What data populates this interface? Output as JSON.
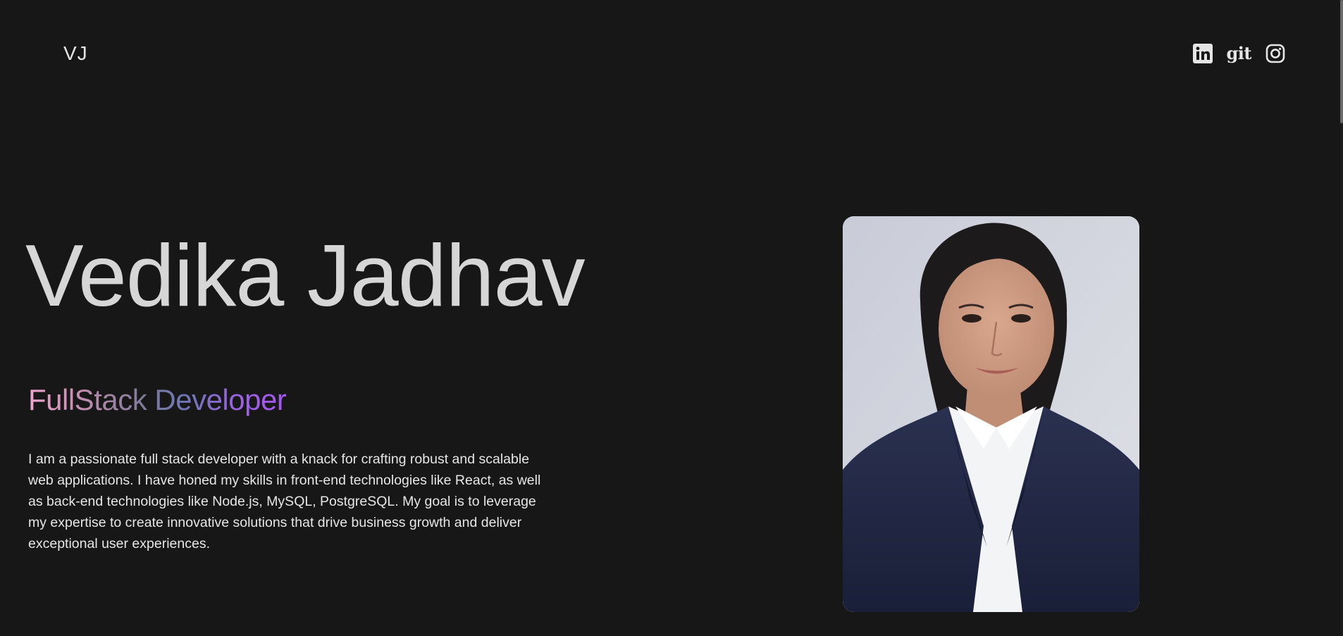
{
  "header": {
    "logo": "VJ",
    "socials": [
      {
        "icon": "linkedin-icon",
        "label": "LinkedIn"
      },
      {
        "icon": "git-icon",
        "label": "git"
      },
      {
        "icon": "instagram-icon",
        "label": "Instagram"
      }
    ]
  },
  "hero": {
    "name": "Vedika Jadhav",
    "role": "FullStack Developer",
    "bio": "I am a passionate full stack developer with a knack for crafting robust and scalable web applications. I have honed my skills in front-end technologies like React, as well as back-end technologies like Node.js, MySQL, PostgreSQL. My goal is to leverage my expertise to create innovative solutions that drive business growth and deliver exceptional user experiences."
  },
  "colors": {
    "background": "#171717",
    "text": "#d6d6d6",
    "gradient_start": "#f0a6d2",
    "gradient_mid": "#6e77b4",
    "gradient_end": "#a855f7"
  }
}
